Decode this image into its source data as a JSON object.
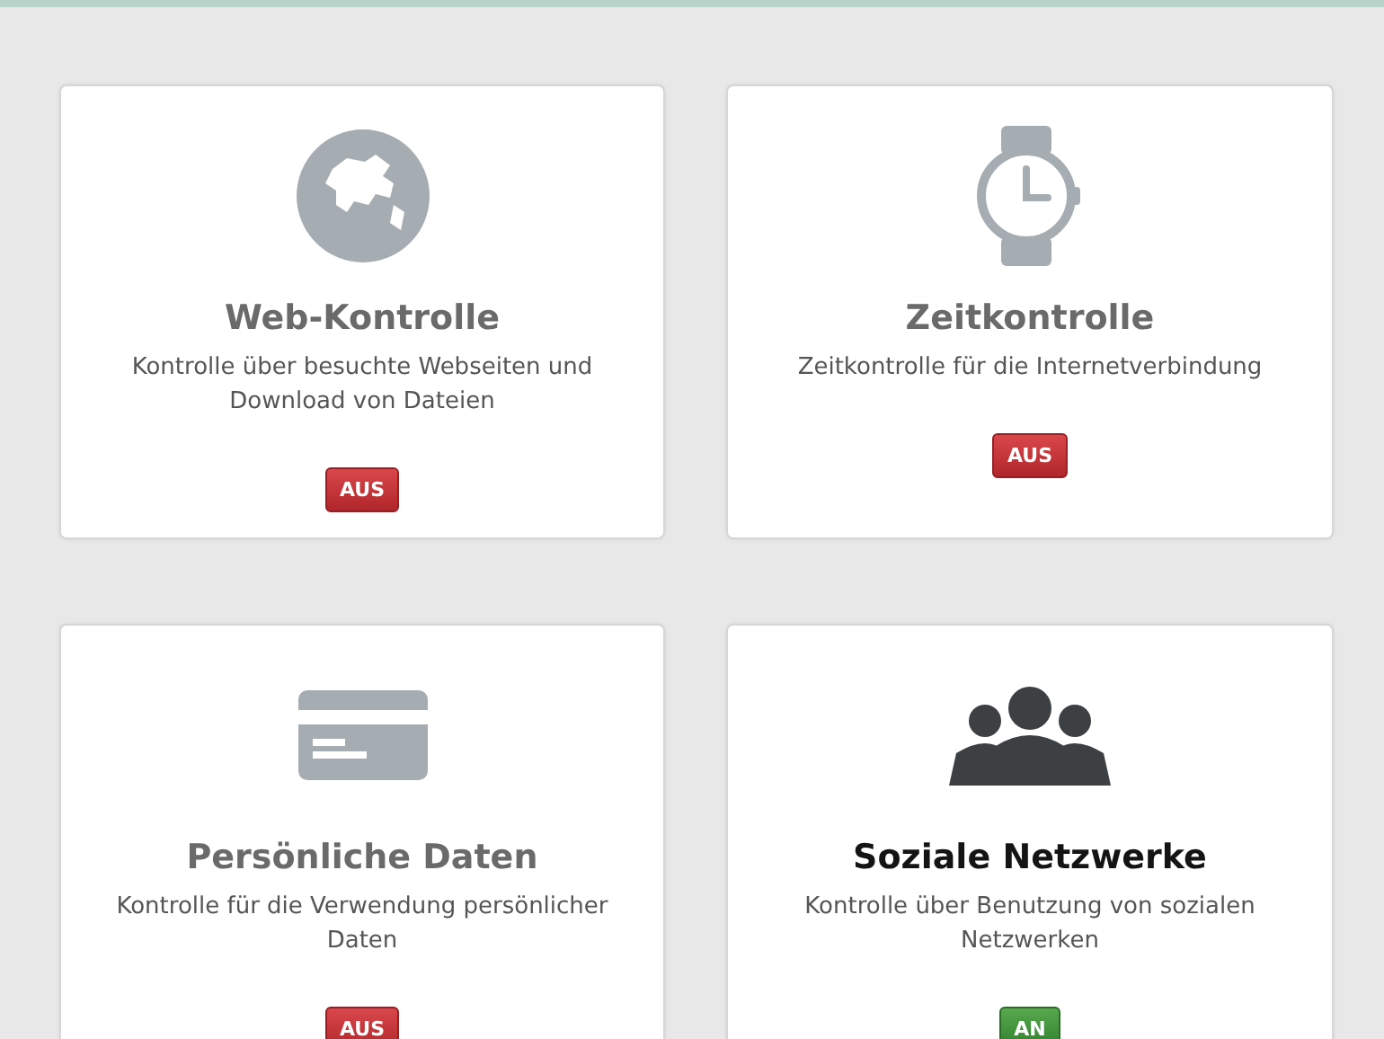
{
  "cards": [
    {
      "kind": "globe",
      "title": "Web-Kontrolle",
      "description": "Kontrolle über besuchte Webseiten und Download von Dateien",
      "on": false,
      "status": "AUS"
    },
    {
      "kind": "watch",
      "title": "Zeitkontrolle",
      "description": "Zeitkontrolle für die Internetverbindung",
      "on": false,
      "status": "AUS"
    },
    {
      "kind": "card",
      "title": "Persönliche Daten",
      "description": "Kontrolle für die Verwendung persönlicher Daten",
      "on": false,
      "status": "AUS"
    },
    {
      "kind": "people",
      "title": "Soziale Netzwerke",
      "description": "Kontrolle über Benutzung von sozialen Netzwerken",
      "on": true,
      "status": "AN"
    }
  ]
}
